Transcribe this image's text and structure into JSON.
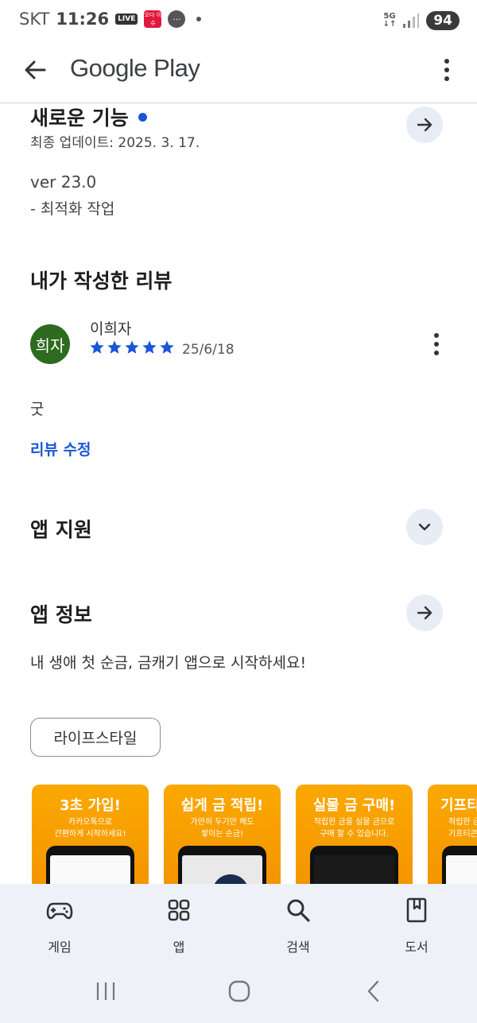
{
  "status_bar": {
    "carrier": "SKT",
    "time": "11:26",
    "live_badge": "LIVE",
    "app_badge": "오다 이슈",
    "network": "5G",
    "battery": "94"
  },
  "app_bar": {
    "title": "Google Play"
  },
  "whats_new": {
    "heading": "새로운 기능",
    "last_updated": "최종 업데이트: 2025. 3. 17.",
    "version": "ver 23.0",
    "notes": "- 최적화 작업"
  },
  "my_review": {
    "heading": "내가 작성한 리뷰",
    "avatar_text": "희자",
    "reviewer": "이희자",
    "rating": 5,
    "date": "25/6/18",
    "body": "굿",
    "edit_label": "리뷰 수정"
  },
  "app_support": {
    "heading": "앱 지원"
  },
  "about_app": {
    "heading": "앱 정보",
    "description": "내 생애 첫 순금, 금캐기 앱으로 시작하세요!",
    "category_chip": "라이프스타일"
  },
  "screenshots": [
    {
      "title": "3초 가입!",
      "subtitle": "카카오톡으로\n간편하게 시작하세요!"
    },
    {
      "title": "쉽게 금 적립!",
      "subtitle": "가만히 두기만 해도\n쌓이는 순금!"
    },
    {
      "title": "실물 금 구매!",
      "subtitle": "적립한 금을 실물 금으로\n구매 할 수 있습니다."
    },
    {
      "title": "기프티",
      "subtitle": "적립한 금\n기프티콘"
    }
  ],
  "bottom_nav": {
    "items": [
      {
        "label": "게임",
        "icon": "gamepad-icon"
      },
      {
        "label": "앱",
        "icon": "apps-grid-icon"
      },
      {
        "label": "검색",
        "icon": "search-icon"
      },
      {
        "label": "도서",
        "icon": "book-icon"
      }
    ]
  },
  "colors": {
    "accent_blue": "#1a56d6",
    "avatar_green": "#2e6b1f",
    "screenshot_orange": "#f9a000",
    "nav_background": "#eef1f8",
    "circle_button": "#e7ecf5"
  }
}
